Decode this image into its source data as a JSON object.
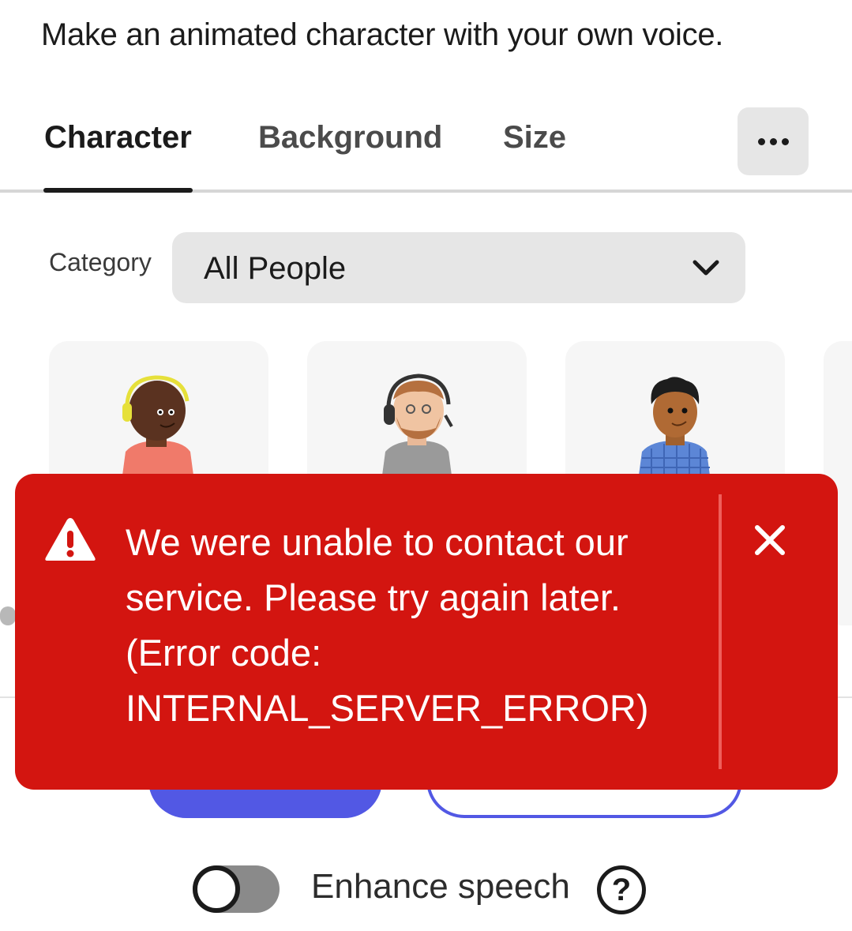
{
  "header": {
    "headline": "Make an animated character with your own voice."
  },
  "tabs": [
    {
      "label": "Character",
      "active": true
    },
    {
      "label": "Background",
      "active": false
    },
    {
      "label": "Size",
      "active": false
    }
  ],
  "more_button_icon": "more-horizontal-icon",
  "category": {
    "label": "Category",
    "selected": "All People"
  },
  "characters": [
    {
      "icon": "character-headset-red-shirt"
    },
    {
      "icon": "character-headset-bearded"
    },
    {
      "icon": "character-blue-plaid-shirt"
    }
  ],
  "toast": {
    "type": "error",
    "lines": [
      "We were unable to contact our",
      "service. Please try again later.",
      "(Error code:",
      "INTERNAL_SERVER_ERROR)"
    ],
    "icon": "warning-icon",
    "close_icon": "close-icon",
    "color": "#d31510"
  },
  "enhance_speech": {
    "label": "Enhance speech",
    "enabled": false,
    "help_icon": "help-icon",
    "help_symbol": "?"
  },
  "colors": {
    "accent": "#5258e4",
    "error": "#d31510"
  }
}
